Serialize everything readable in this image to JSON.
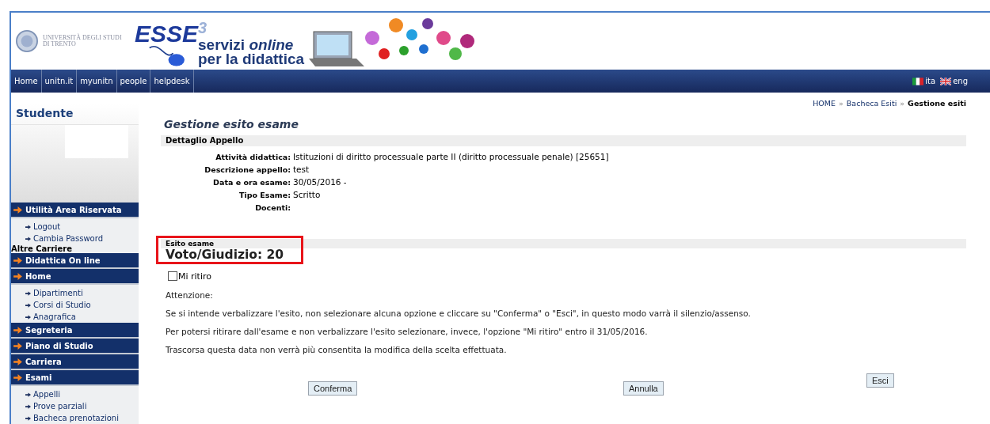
{
  "header": {
    "university_lines": [
      "UNIVERSITÀ DEGLI STUDI",
      "DI TRENTO"
    ],
    "logo_title": "ESSE$^{3}$",
    "tagline_lines": [
      "servizi *online*",
      "per la didattica"
    ]
  },
  "nav": {
    "links": [
      "Home",
      "unitn.it",
      "myunitn",
      "people",
      "helpdesk"
    ],
    "languages": [
      {
        "kind": "italy",
        "label": "ita"
      },
      {
        "kind": "uk",
        "label": "eng"
      }
    ]
  },
  "sidebar": {
    "title": "Studente",
    "items": [
      {
        "kind": "section",
        "label": "Utilità Area Riservata"
      },
      {
        "kind": "link",
        "label": "Logout"
      },
      {
        "kind": "link",
        "label": "Cambia Password"
      },
      {
        "kind": "label",
        "label": "Altre Carriere"
      },
      {
        "kind": "section",
        "label": "Didattica On line"
      },
      {
        "kind": "section",
        "label": "Home"
      },
      {
        "kind": "link",
        "label": "Dipartimenti"
      },
      {
        "kind": "link",
        "label": "Corsi di Studio"
      },
      {
        "kind": "link",
        "label": "Anagrafica"
      },
      {
        "kind": "section",
        "label": "Segreteria"
      },
      {
        "kind": "section",
        "label": "Piano di Studio"
      },
      {
        "kind": "section",
        "label": "Carriera"
      },
      {
        "kind": "section",
        "label": "Esami"
      },
      {
        "kind": "link",
        "label": "Appelli"
      },
      {
        "kind": "link",
        "label": "Prove parziali"
      },
      {
        "kind": "link",
        "label": "Bacheca prenotazioni"
      }
    ]
  },
  "breadcrumb": {
    "separator": "»",
    "items": [
      {
        "label": "HOME",
        "current": false
      },
      {
        "label": "Bacheca Esiti",
        "current": false
      },
      {
        "label": "Gestione esiti",
        "current": true
      }
    ]
  },
  "page_title": "Gestione esito esame",
  "detail": {
    "heading": "Dettaglio Appello",
    "fields": [
      {
        "label": "Attività didattica:",
        "value": "Istituzioni di diritto processuale parte II (diritto processuale penale) [25651]"
      },
      {
        "label": "Descrizione appello:",
        "value": "test"
      },
      {
        "label": "Data e ora esame:",
        "value": "30/05/2016 -"
      },
      {
        "label": "Tipo Esame:",
        "value": "Scritto"
      },
      {
        "label": "Docenti:"
      }
    ]
  },
  "result": {
    "heading": "Esito esame",
    "grade": "Voto/Giudizio: 20",
    "highlighted": true,
    "withdraw": {
      "label": "Mi ritiro",
      "checked": false
    }
  },
  "notice": [
    "Attenzione:",
    "Se si intende verbalizzare l'esito, non selezionare alcuna opzione e cliccare su \"Conferma\" o \"Esci\", in questo modo varrà il silenzio/assenso.",
    "Per potersi ritirare dall'esame e non verbalizzare l'esito selezionare, invece, l'opzione \"Mi ritiro\" entro il 31/05/2016.",
    "Trascorsa questa data non verrà più consentita la modifica della scelta effettuata."
  ],
  "buttons": [
    {
      "kind": "confirm",
      "label": "Conferma"
    },
    {
      "kind": "cancel",
      "label": "Annulla"
    },
    {
      "kind": "exit",
      "label": "Esci"
    }
  ]
}
